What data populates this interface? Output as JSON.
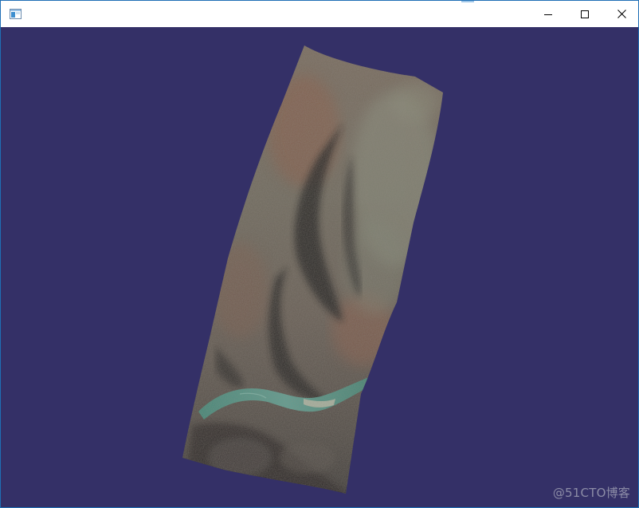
{
  "window": {
    "title": "",
    "icon": "app-window-icon",
    "controls": {
      "minimize_icon": "minimize-icon",
      "maximize_icon": "maximize-icon",
      "close_icon": "close-icon"
    }
  },
  "viewport": {
    "background_color": "#343067",
    "content": "textured-terrain-mesh"
  },
  "watermark": {
    "text": "@51CTO博客"
  }
}
